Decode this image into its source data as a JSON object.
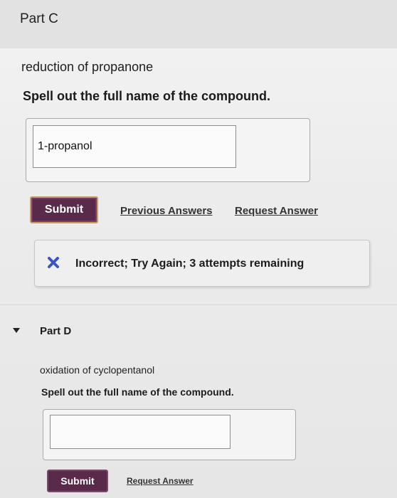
{
  "part_c": {
    "title": "Part C",
    "prompt": "reduction of propanone",
    "instruction": "Spell out the full name of the compound.",
    "answer_value": "1-propanol",
    "submit_label": "Submit",
    "previous_answers_label": "Previous Answers",
    "request_answer_label": "Request Answer",
    "feedback": {
      "icon": "x-icon",
      "icon_color": "#3b54c4",
      "text": "Incorrect; Try Again; 3 attempts remaining"
    }
  },
  "part_d": {
    "title": "Part D",
    "prompt": "oxidation of cyclopentanol",
    "instruction": "Spell out the full name of the compound.",
    "answer_value": "",
    "submit_label": "Submit",
    "request_answer_label": "Request Answer"
  },
  "colors": {
    "submit_bg": "#5a2a4a",
    "link": "#333333"
  }
}
